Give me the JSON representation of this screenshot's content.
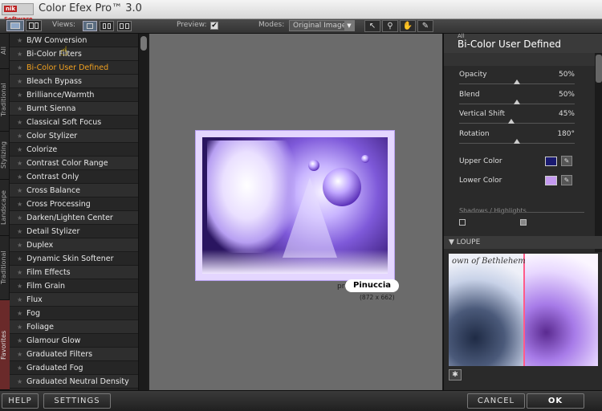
{
  "app": {
    "logo_text": "nik",
    "logo_sub": "Software",
    "title": "Color Efex Pro™ 3.0"
  },
  "toolbar": {
    "views_label": "Views:",
    "preview_label": "Preview:",
    "preview_checked": "✔",
    "modes_label": "Modes:",
    "mode_value": "Original Image",
    "tools": [
      "pointer-icon",
      "zoom-icon",
      "hand-icon",
      "eyedropper-icon"
    ]
  },
  "vtabs": [
    "All",
    "Traditional",
    "Stylizing",
    "Landscape",
    "Traditional",
    "Favorites"
  ],
  "filters": [
    "B/W Conversion",
    "Bi-Color Filters",
    "Bi-Color User Defined",
    "Bleach Bypass",
    "Brilliance/Warmth",
    "Burnt Sienna",
    "Classical Soft Focus",
    "Color Stylizer",
    "Colorize",
    "Contrast Color Range",
    "Contrast Only",
    "Cross Balance",
    "Cross Processing",
    "Darken/Lighten Center",
    "Detail Stylizer",
    "Duplex",
    "Dynamic Skin Softener",
    "Film Effects",
    "Film Grain",
    "Flux",
    "Fog",
    "Foliage",
    "Glamour Glow",
    "Graduated Filters",
    "Graduated Fog",
    "Graduated Neutral Density"
  ],
  "selected_filter": "Bi-Color User Defined",
  "preview": {
    "caption_pre": "pri",
    "caption_name": "Pinuccia",
    "caption_size": "(872 x 662)"
  },
  "panel": {
    "category": "All",
    "title": "Bi-Color User Defined",
    "params": [
      {
        "label": "Opacity",
        "value": "50%",
        "fraction": 0.5
      },
      {
        "label": "Blend",
        "value": "50%",
        "fraction": 0.5
      },
      {
        "label": "Vertical Shift",
        "value": "45%",
        "fraction": 0.45
      },
      {
        "label": "Rotation",
        "value": "180°",
        "fraction": 0.5
      }
    ],
    "upper_color_label": "Upper Color",
    "upper_color": "#1a1a70",
    "lower_color_label": "Lower Color",
    "lower_color": "#c49af0",
    "shadows_label": "Shadows / Highlights",
    "loupe_label": "LOUPE",
    "loupe_text": "own of Bethlehem"
  },
  "bottom": {
    "help": "HELP",
    "settings": "SETTINGS",
    "cancel": "CANCEL",
    "ok": "OK"
  }
}
